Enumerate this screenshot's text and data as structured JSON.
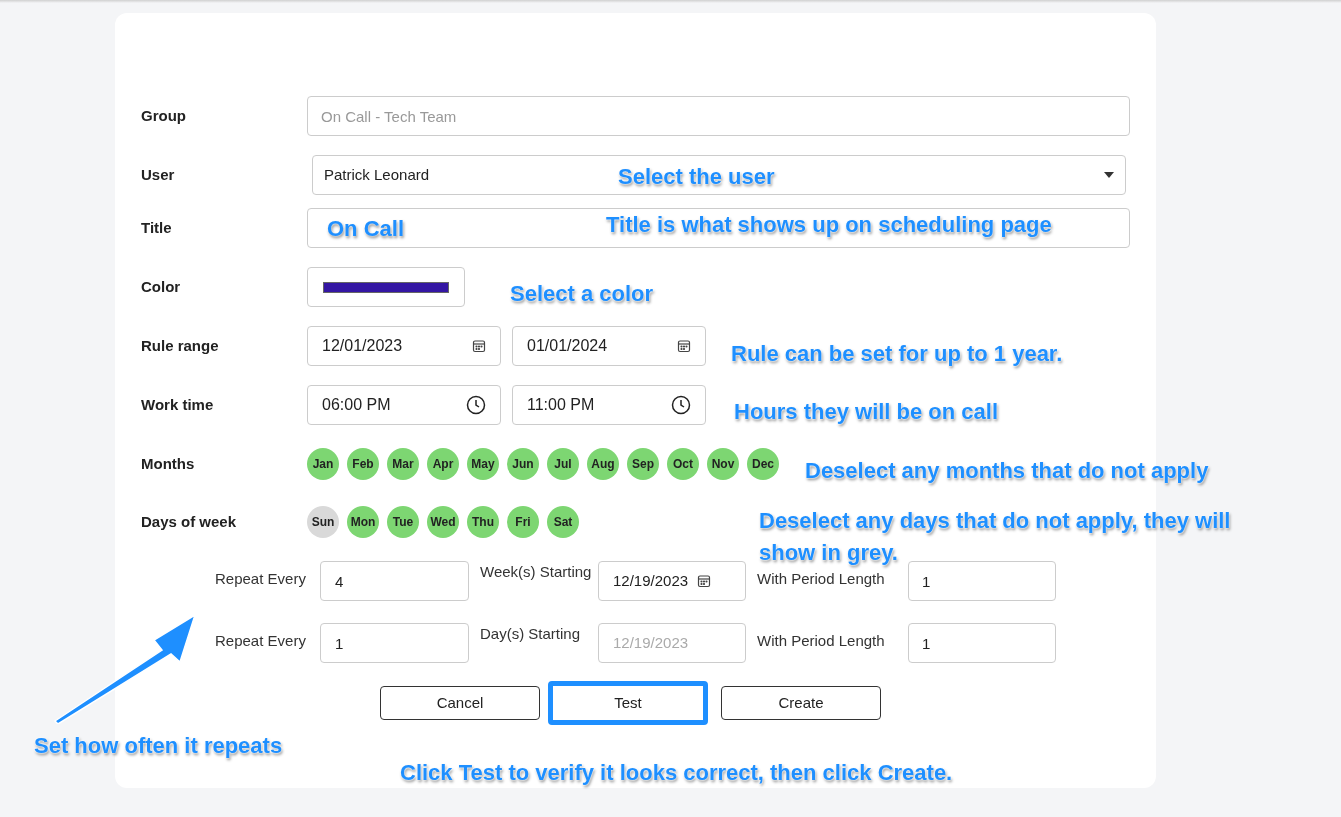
{
  "form": {
    "group": {
      "label": "Group",
      "placeholder": "On Call - Tech Team"
    },
    "user": {
      "label": "User",
      "value": "Patrick Leonard"
    },
    "title": {
      "label": "Title",
      "value": "On Call"
    },
    "color": {
      "label": "Color",
      "color": "#3416a3"
    },
    "rule_range": {
      "label": "Rule range",
      "start": "12/01/2023",
      "end": "01/01/2024"
    },
    "work_time": {
      "label": "Work time",
      "start": "06:00 PM",
      "end": "11:00 PM"
    },
    "months": {
      "label": "Months",
      "items": [
        {
          "label": "Jan",
          "selected": true
        },
        {
          "label": "Feb",
          "selected": true
        },
        {
          "label": "Mar",
          "selected": true
        },
        {
          "label": "Apr",
          "selected": true
        },
        {
          "label": "May",
          "selected": true
        },
        {
          "label": "Jun",
          "selected": true
        },
        {
          "label": "Jul",
          "selected": true
        },
        {
          "label": "Aug",
          "selected": true
        },
        {
          "label": "Sep",
          "selected": true
        },
        {
          "label": "Oct",
          "selected": true
        },
        {
          "label": "Nov",
          "selected": true
        },
        {
          "label": "Dec",
          "selected": true
        }
      ]
    },
    "days_of_week": {
      "label": "Days of week",
      "items": [
        {
          "label": "Sun",
          "selected": false
        },
        {
          "label": "Mon",
          "selected": true
        },
        {
          "label": "Tue",
          "selected": true
        },
        {
          "label": "Wed",
          "selected": true
        },
        {
          "label": "Thu",
          "selected": true
        },
        {
          "label": "Fri",
          "selected": true
        },
        {
          "label": "Sat",
          "selected": true
        }
      ]
    },
    "repeat_rows": [
      {
        "label": "Repeat Every",
        "value": "4",
        "unit_label": "Week(s) Starting",
        "start_date": "12/19/2023",
        "disabled": false,
        "period_label": "With Period Length",
        "period": "1"
      },
      {
        "label": "Repeat Every",
        "value": "1",
        "unit_label": "Day(s) Starting",
        "start_date": "12/19/2023",
        "disabled": true,
        "period_label": "With Period Length",
        "period": "1"
      }
    ]
  },
  "buttons": [
    {
      "label": "Cancel",
      "highlighted": false
    },
    {
      "label": "Test",
      "highlighted": true
    },
    {
      "label": "Create",
      "highlighted": false
    }
  ],
  "annotations": [
    {
      "text": "Select the user"
    },
    {
      "text": "Title is what shows up on scheduling page"
    },
    {
      "text": "Select a color"
    },
    {
      "text": "Rule can be set for up to 1 year."
    },
    {
      "text": "Hours they will be on call"
    },
    {
      "text": "Deselect any months that do not apply"
    },
    {
      "text": "Deselect any days that do not apply, they will show in grey."
    },
    {
      "text": "Set how often it repeats"
    },
    {
      "text": "Click Test to verify it looks correct, then click Create."
    }
  ]
}
